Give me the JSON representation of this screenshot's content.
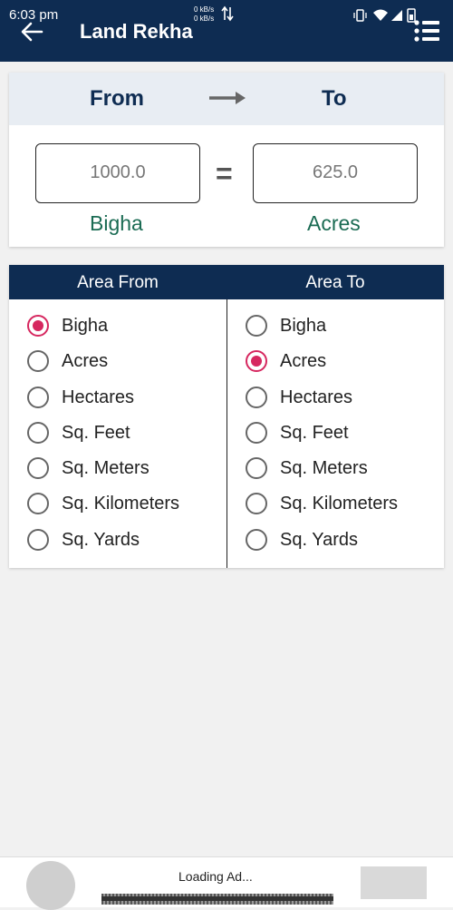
{
  "status_bar": {
    "time": "6:03 pm",
    "net_up": "0 kB/s",
    "net_down": "0 kB/s"
  },
  "app_bar": {
    "title": "Land Rekha",
    "back_icon": "back-arrow-icon",
    "menu_icon": "hamburger-menu-icon"
  },
  "converter": {
    "from_heading": "From",
    "to_heading": "To",
    "from_value": "1000.0",
    "to_value": "625.0",
    "equals_sign": "=",
    "from_unit": "Bigha",
    "to_unit": "Acres"
  },
  "area_from": {
    "header": "Area From",
    "selected": "Bigha",
    "options": [
      "Bigha",
      "Acres",
      "Hectares",
      "Sq. Feet",
      "Sq. Meters",
      "Sq. Kilometers",
      "Sq. Yards"
    ]
  },
  "area_to": {
    "header": "Area To",
    "selected": "Acres",
    "options": [
      "Bigha",
      "Acres",
      "Hectares",
      "Sq. Feet",
      "Sq. Meters",
      "Sq. Kilometers",
      "Sq. Yards"
    ]
  },
  "ad": {
    "status": "Loading Ad..."
  },
  "colors": {
    "primary": "#0e2c52",
    "accent_radio": "#d6275f",
    "unit_label": "#1a6b53"
  }
}
